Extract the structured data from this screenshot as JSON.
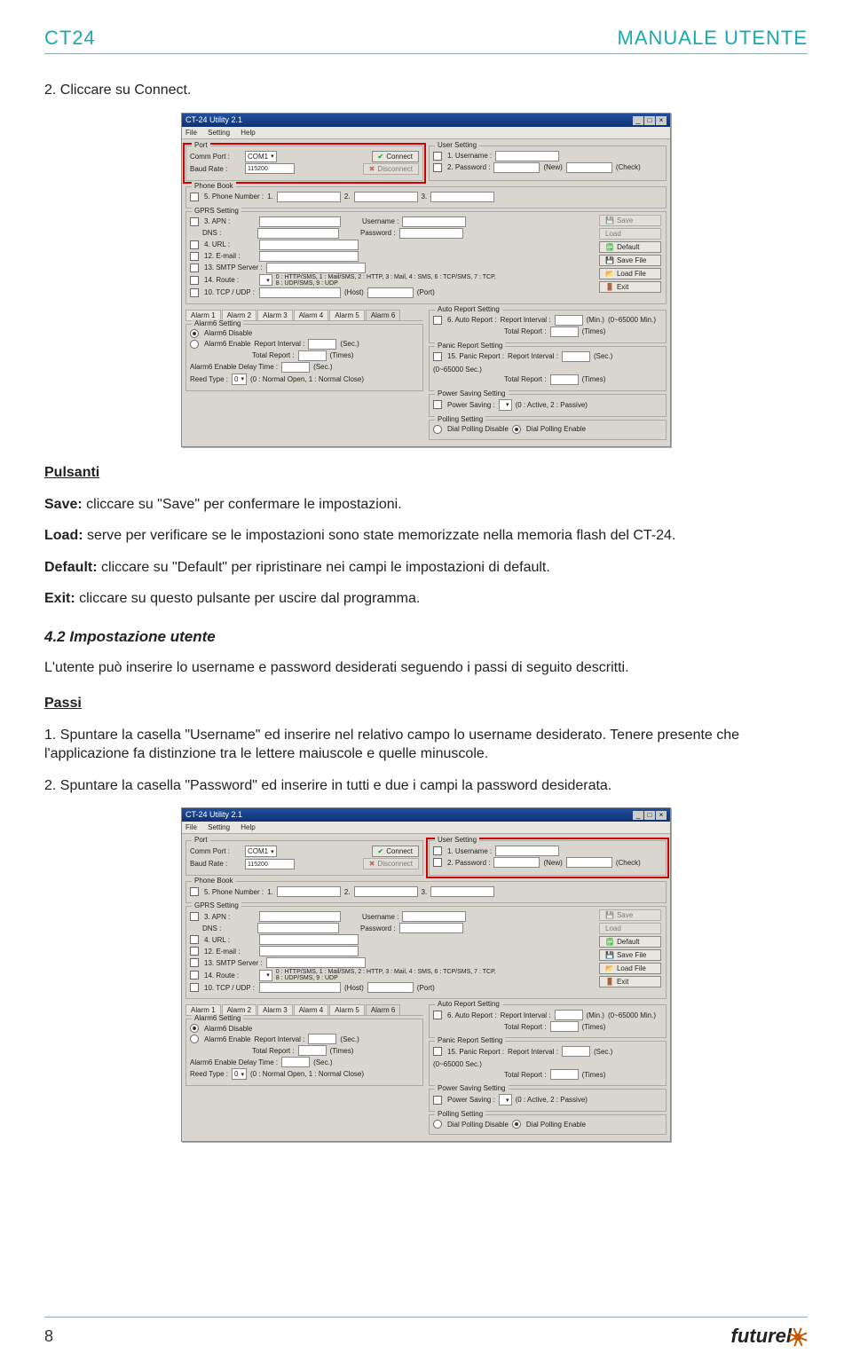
{
  "header": {
    "left": "CT24",
    "right": "MANUALE UTENTE"
  },
  "intro": "2. Cliccare su Connect.",
  "pulsanti": {
    "title": "Pulsanti",
    "save": {
      "bold": "Save:",
      "text": " cliccare su \"Save\" per confermare le impostazioni."
    },
    "load": {
      "bold": "Load:",
      "text": " serve per verificare se le impostazioni sono state memorizzate nella memoria flash del CT-24."
    },
    "default": {
      "bold": "Default:",
      "text": " cliccare su \"Default\" per ripristinare nei campi le impostazioni di default."
    },
    "exit": {
      "bold": "Exit:",
      "text": " cliccare su questo pulsante per uscire dal programma."
    }
  },
  "section42": {
    "heading": "4.2 Impostazione utente",
    "intro": "L'utente può inserire lo username e password desiderati seguendo i passi di seguito descritti.",
    "passi_label": "Passi",
    "p1": "1. Spuntare la casella \"Username\" ed inserire nel relativo campo lo username desiderato. Tenere presente che l'applicazione fa distinzione tra le lettere maiuscole e quelle minuscole.",
    "p2": "2. Spuntare la casella \"Password\" ed inserire in tutti e due i campi la password desiderata."
  },
  "footer": {
    "page": "8",
    "brand": "futurel"
  },
  "mock": {
    "title": "CT-24 Utility 2.1",
    "menu": {
      "file": "File",
      "setting": "Setting",
      "help": "Help"
    },
    "port": {
      "legend": "Port",
      "comm": "Comm Port :",
      "comm_val": "COM1",
      "baud": "Baud Rate :",
      "baud_val": "115200",
      "connect": "Connect",
      "disconnect": "Disconnect"
    },
    "user": {
      "legend": "User Setting",
      "u_ck": "1. Username :",
      "p_ck": "2. Password :",
      "new": "(New)",
      "check": "(Check)"
    },
    "phone": {
      "legend": "Phone Book",
      "lbl": "5. Phone Number :",
      "n1": "1.",
      "n2": "2.",
      "n3": "3."
    },
    "gprs": {
      "legend": "GPRS Setting",
      "apn": "3. APN :",
      "dns": "DNS :",
      "user": "Username :",
      "pass": "Password :",
      "url": "4. URL :",
      "email": "12. E-mail :",
      "smtp": "13. SMTP Server :",
      "route": "14. Route :",
      "route_note": "0 : HTTP/SMS, 1 : Mail/SMS, 2 : HTTP, 3 : Mail, 4 : SMS, 6 : TCP/SMS, 7 : TCP, 8 : UDP/SMS, 9 : UDP",
      "tcp": "10. TCP / UDP :",
      "host": "(Host)",
      "port": "(Port)"
    },
    "side": {
      "save": "Save",
      "load": "Load",
      "default": "Default",
      "savefile": "Save File",
      "loadfile": "Load File",
      "exit": "Exit"
    },
    "alarm": {
      "tabs": [
        "Alarm 1",
        "Alarm 2",
        "Alarm 3",
        "Alarm 4",
        "Alarm 5",
        "Alarm 6"
      ],
      "legend": "Alarm6 Setting",
      "disable": "Alarm6 Disable",
      "enable": "Alarm6 Enable",
      "ri": "Report Interval :",
      "sec": "(Sec.)",
      "tr": "Total Report :",
      "times": "(Times)",
      "dly": "Alarm6 Enable Delay Time :",
      "reed": "Reed Type :",
      "reed_val": "0",
      "reed_note": "(0 : Normal Open, 1 : Normal Close)"
    },
    "auto": {
      "legend": "Auto Report Setting",
      "ck": "6. Auto Report :",
      "ri": "Report Interval :",
      "min": "(Min.)",
      "note": "(0~65000 Min.)",
      "tr": "Total Report :",
      "times": "(Times)"
    },
    "panic": {
      "legend": "Panic Report Setting",
      "ck": "15. Panic Report :",
      "ri": "Report Interval :",
      "sec": "(Sec.)",
      "note": "(0~65000 Sec.)",
      "tr": "Total Report :",
      "times": "(Times)"
    },
    "power": {
      "legend": "Power Saving Setting",
      "ck": "Power Saving :",
      "note": "(0 : Active, 2 : Passive)"
    },
    "poll": {
      "legend": "Polling Setting",
      "d": "Dial Polling Disable",
      "e": "Dial Polling Enable"
    }
  }
}
